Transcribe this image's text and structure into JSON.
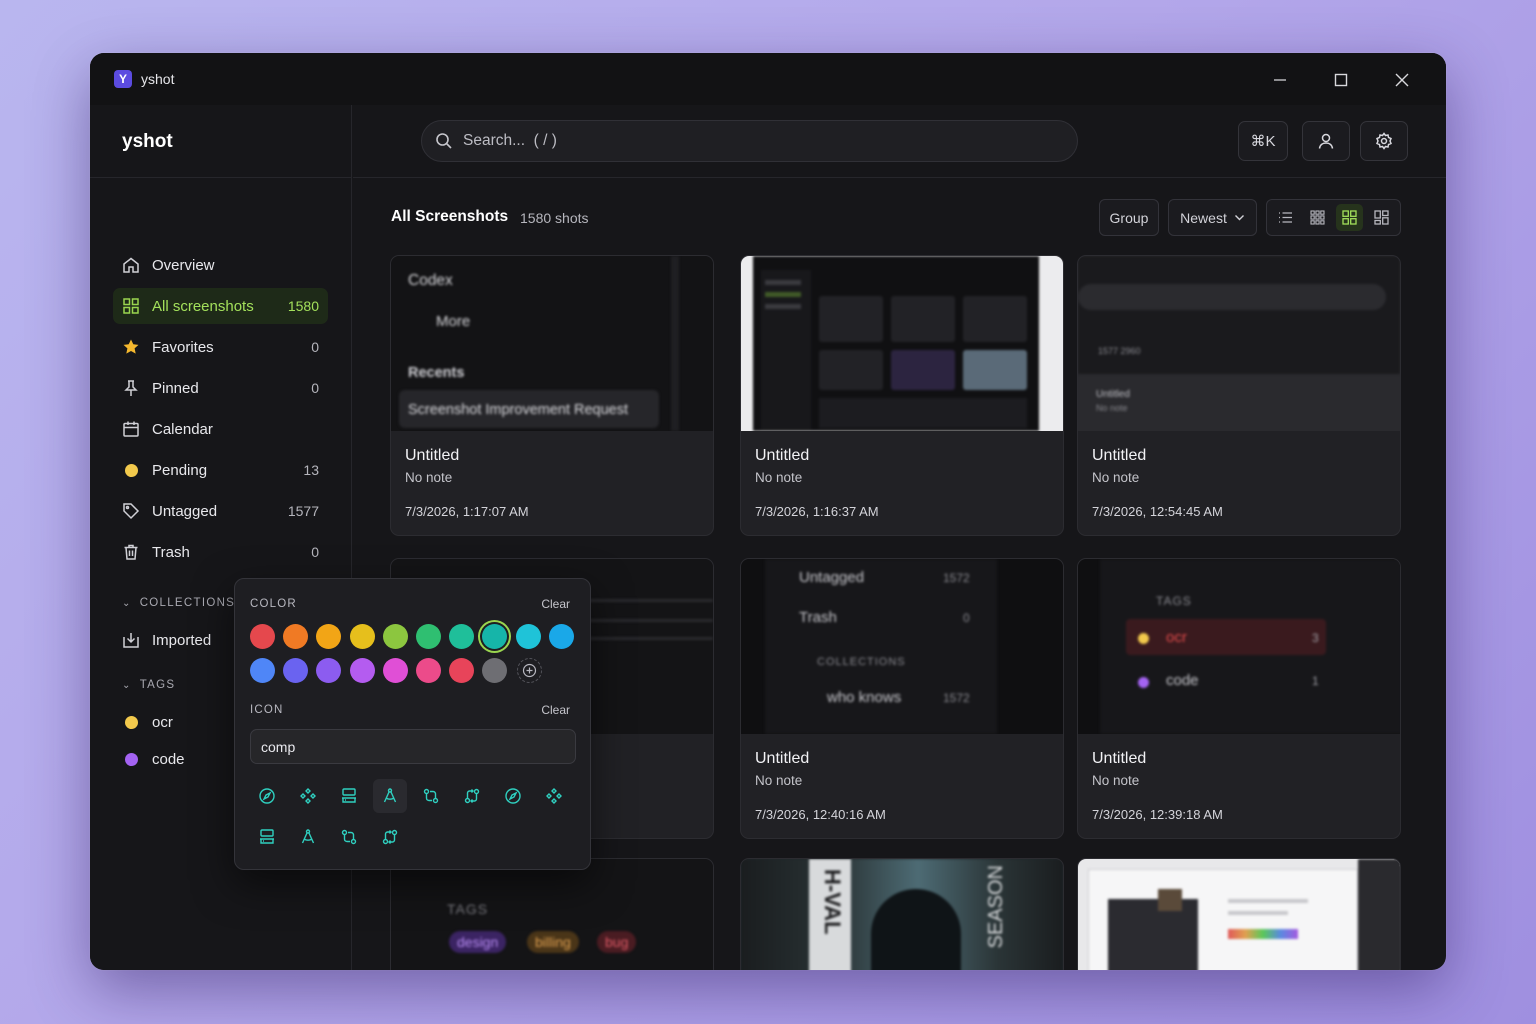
{
  "window": {
    "title": "yshot",
    "logo_letter": "Y"
  },
  "sidebar": {
    "brand": "yshot",
    "items": [
      {
        "label": "Overview",
        "count": "",
        "icon": "home-icon"
      },
      {
        "label": "All screenshots",
        "count": "1580",
        "icon": "grid-icon"
      },
      {
        "label": "Favorites",
        "count": "0",
        "icon": "star-icon"
      },
      {
        "label": "Pinned",
        "count": "0",
        "icon": "pin-icon"
      },
      {
        "label": "Calendar",
        "count": "",
        "icon": "calendar-icon"
      },
      {
        "label": "Pending",
        "count": "13",
        "icon": "yellow-dot-icon"
      },
      {
        "label": "Untagged",
        "count": "1577",
        "icon": "tag-icon"
      },
      {
        "label": "Trash",
        "count": "0",
        "icon": "trash-icon"
      }
    ],
    "collections_header": "COLLECTIONS",
    "collections": [
      {
        "label": "Imported",
        "icon": "import-icon"
      }
    ],
    "tags_header": "TAGS",
    "tags": [
      {
        "label": "ocr",
        "color": "#f2c94c"
      },
      {
        "label": "code",
        "color": "#a463f2"
      }
    ]
  },
  "topbar": {
    "search_placeholder": "Search...  ( / )",
    "shortcut_label": "⌘K"
  },
  "main": {
    "title": "All Screenshots",
    "count": "1580 shots",
    "group_label": "Group",
    "sort_label": "Newest",
    "cards": [
      {
        "title": "Untitled",
        "note": "No note",
        "date": "7/3/2026, 1:17:07 AM"
      },
      {
        "title": "Untitled",
        "note": "No note",
        "date": "7/3/2026, 1:16:37 AM"
      },
      {
        "title": "Untitled",
        "note": "No note",
        "date": "7/3/2026, 12:54:45 AM"
      },
      {
        "title": "",
        "note": "",
        "date": ""
      },
      {
        "title": "Untitled",
        "note": "No note",
        "date": "7/3/2026, 12:40:16 AM"
      },
      {
        "title": "Untitled",
        "note": "No note",
        "date": "7/3/2026, 12:39:18 AM"
      }
    ],
    "thumbs": {
      "t1": {
        "a": "Codex",
        "b": "More",
        "c": "Recents",
        "d": "Screenshot Improvement Request"
      },
      "t3": {
        "a": "Untitled",
        "b": "No note",
        "c": "1577 2960"
      },
      "t5": {
        "a": "Untagged",
        "a_count": "1572",
        "b": "Trash",
        "b_count": "0",
        "c": "COLLECTIONS",
        "d": "who knows",
        "d_count": "1572"
      },
      "t6": {
        "a": "TAGS",
        "b": "ocr",
        "b_count": "3",
        "c": "code",
        "c_count": "1"
      },
      "t7": {
        "a": "TAGS",
        "b": "design",
        "c": "billing",
        "d": "bug"
      },
      "t8": {
        "a": "H-VAL",
        "b": "SEASON"
      }
    }
  },
  "popover": {
    "color_label": "COLOR",
    "clear_label": "Clear",
    "icon_label": "ICON",
    "icon_clear_label": "Clear",
    "icon_query": "comp",
    "colors": [
      "#e5484d",
      "#f07a24",
      "#f2a516",
      "#e6bf1c",
      "#8cc63f",
      "#2fbf71",
      "#1fbf9a",
      "#16b5a9",
      "#1fc3d8",
      "#1aa8e8",
      "#4f86f7",
      "#6a63f0",
      "#8c5cf0",
      "#b45cf0",
      "#e04fd6",
      "#ec4b8a",
      "#e8445a",
      "#6e6e73"
    ],
    "selected_color": "#16b5a9",
    "icon_color": "#2fd0c0"
  }
}
